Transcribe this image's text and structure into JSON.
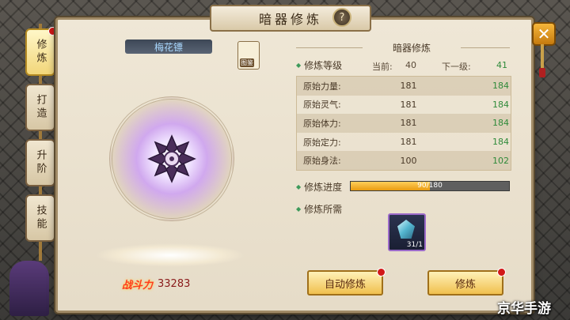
{
  "window": {
    "title": "暗器修炼",
    "help_glyph": "?",
    "close_glyph": "✕"
  },
  "tabs": [
    {
      "label": "修炼",
      "active": true,
      "badge": true
    },
    {
      "label": "打造",
      "active": false,
      "badge": false
    },
    {
      "label": "升阶",
      "active": false,
      "badge": false
    },
    {
      "label": "技能",
      "active": false,
      "badge": false
    }
  ],
  "weapon": {
    "name": "梅花镖",
    "book_label": "图鉴",
    "power_label": "战斗力",
    "power_value": "33283"
  },
  "cultivation": {
    "section_title": "暗器修炼",
    "level_label": "修炼等级",
    "current_label": "当前:",
    "current_value": "40",
    "next_label": "下一级:",
    "next_value": "41",
    "stats": [
      {
        "name": "原始力量:",
        "current": "181",
        "next": "184"
      },
      {
        "name": "原始灵气:",
        "current": "181",
        "next": "184"
      },
      {
        "name": "原始体力:",
        "current": "181",
        "next": "184"
      },
      {
        "name": "原始定力:",
        "current": "181",
        "next": "184"
      },
      {
        "name": "原始身法:",
        "current": "100",
        "next": "102"
      }
    ],
    "progress_label": "修炼进度",
    "progress_text": "90/180",
    "progress_fraction": 0.5,
    "requirement_label": "修炼所需",
    "requirement_count": "31/1"
  },
  "buttons": {
    "auto_label": "自动修炼",
    "train_label": "修炼"
  },
  "watermark": "京华手游"
}
